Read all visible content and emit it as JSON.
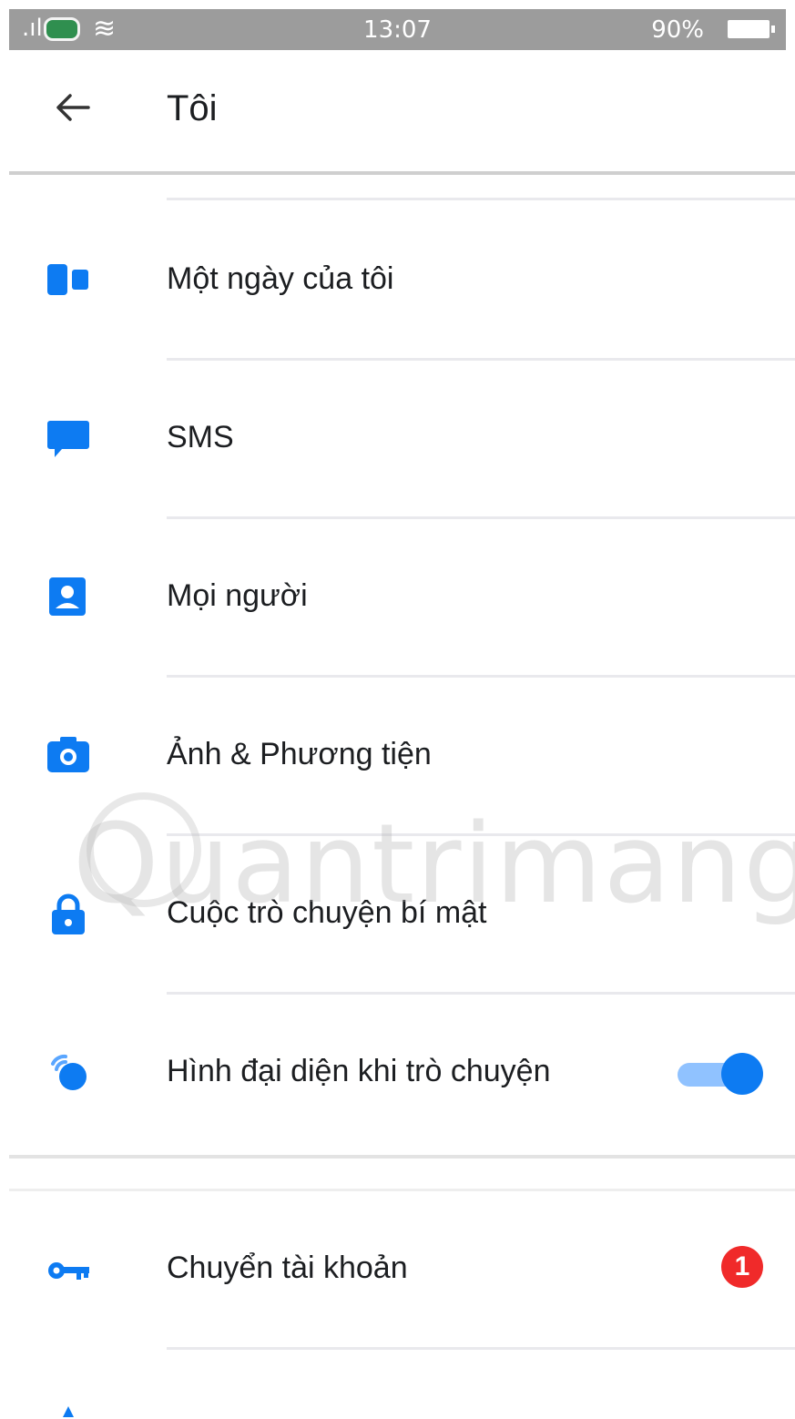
{
  "status_bar": {
    "time": "13:07",
    "battery": "90%"
  },
  "header": {
    "title": "Tôi"
  },
  "menu": {
    "items": [
      {
        "label": "Một ngày của tôi",
        "icon": "my-day-icon"
      },
      {
        "label": "SMS",
        "icon": "sms-bubble-icon"
      },
      {
        "label": "Mọi người",
        "icon": "contact-card-icon"
      },
      {
        "label": "Ảnh & Phương tiện",
        "icon": "camera-icon"
      },
      {
        "label": "Cuộc trò chuyện bí mật",
        "icon": "lock-icon"
      },
      {
        "label": "Hình đại diện khi trò chuyện",
        "icon": "chat-heads-icon",
        "toggle_on": true
      }
    ],
    "account_items": [
      {
        "label": "Chuyển tài khoản",
        "icon": "key-icon",
        "badge": "1"
      }
    ]
  },
  "colors": {
    "accent": "#0d7bf2",
    "badge": "#f02a2a",
    "status_bar": "#9c9c9c"
  },
  "watermark": "Quantrimang"
}
